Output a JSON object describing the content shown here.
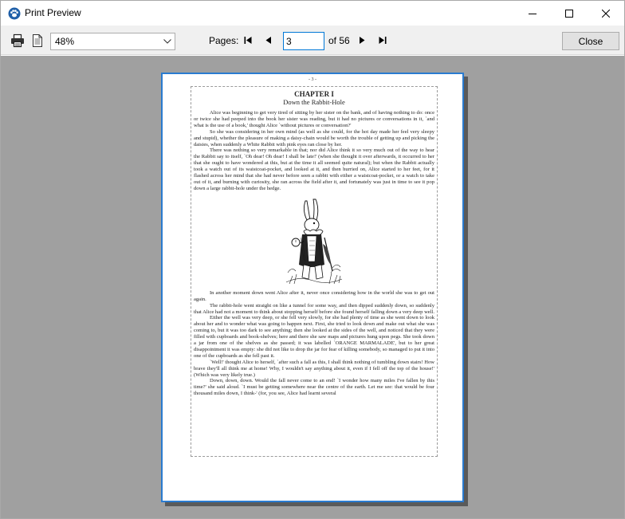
{
  "window": {
    "title": "Print Preview"
  },
  "toolbar": {
    "zoom_value": "48%",
    "pages_label": "Pages:",
    "current_page": "3",
    "of_label": "of 56",
    "close_label": "Close"
  },
  "page": {
    "number_label": "- 3 -",
    "chapter_title": "CHAPTER I",
    "chapter_subtitle": "Down the Rabbit-Hole",
    "paragraphs_top": [
      "Alice was beginning to get very tired of sitting by her sister on the bank, and of having nothing to do: once or twice she had peeped into the book her sister was reading, but it had no pictures or conversations in it, `and what is the use of a book,' thought Alice `without pictures or conversation?'",
      "So she was considering in her own mind (as well as she could, for the hot day made her feel very sleepy and stupid), whether the pleasure of making a daisy-chain would be worth the trouble of getting up and picking the daisies, when suddenly a White Rabbit with pink eyes ran close by her.",
      "There was nothing so very remarkable in that; nor did Alice think it so very much out of the way to hear the Rabbit say to itself, `Oh dear! Oh dear! I shall be late!' (when she thought it over afterwards, it occurred to her that she ought to have wondered at this, but at the time it all seemed quite natural); but when the Rabbit actually took a watch out of its waistcoat-pocket, and looked at it, and then hurried on, Alice started to her feet, for it flashed across her mind that she had never before seen a rabbit with either a waistcoat-pocket, or a watch to take out of it, and burning with curiosity, she ran across the field after it, and fortunately was just in time to see it pop down a large rabbit-hole under the hedge."
    ],
    "paragraphs_bottom": [
      "In another moment down went Alice after it, never once considering how in the world she was to get out again.",
      "The rabbit-hole went straight on like a tunnel for some way, and then dipped suddenly down, so suddenly that Alice had not a moment to think about stopping herself before she found herself falling down a very deep well.",
      "Either the well was very deep, or she fell very slowly, for she had plenty of time as she went down to look about her and to wonder what was going to happen next. First, she tried to look down and make out what she was coming to, but it was too dark to see anything; then she looked at the sides of the well, and noticed that they were filled with cupboards and book-shelves; here and there she saw maps and pictures hung upon pegs. She took down a jar from one of the shelves as she passed; it was labelled `ORANGE MARMALADE', but to her great disappointment it was empty: she did not like to drop the jar for fear of killing somebody, so managed to put it into one of the cupboards as she fell past it.",
      "`Well!' thought Alice to herself, `after such a fall as this, I shall think nothing of tumbling down stairs! How brave they'll all think me at home! Why, I wouldn't say anything about it, even if I fell off the top of the house!' (Which was very likely true.)",
      "Down, down, down. Would the fall never come to an end! `I wonder how many miles I've fallen by this time?' she said aloud. `I must be getting somewhere near the centre of the earth. Let me see: that would be four thousand miles down, I think-' (for, you see, Alice had learnt several"
    ]
  },
  "icons": {
    "app": "paw-icon",
    "print": "printer-icon",
    "page_setup": "page-setup-icon",
    "first": "first-page-icon",
    "prev": "previous-page-icon",
    "next": "next-page-icon",
    "last": "last-page-icon"
  },
  "colors": {
    "page_border": "#2a7bd0",
    "preview_background": "#a0a0a0",
    "input_focus": "#0078d7"
  }
}
